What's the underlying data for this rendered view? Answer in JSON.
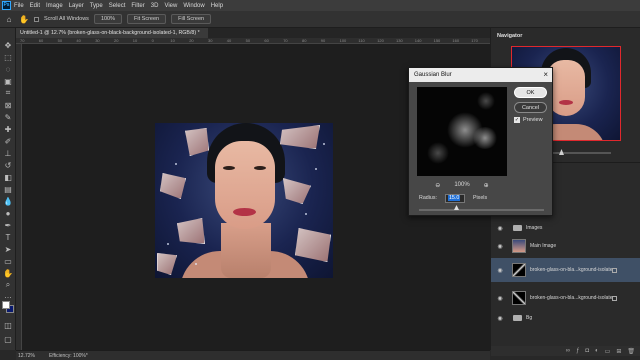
{
  "app": {
    "logo": "Ps"
  },
  "menu": [
    "File",
    "Edit",
    "Image",
    "Layer",
    "Type",
    "Select",
    "Filter",
    "3D",
    "View",
    "Window",
    "Help"
  ],
  "options": {
    "scroll_all_windows": "Scroll All Windows",
    "zoom_value": "100%",
    "fit_screen": "Fit Screen",
    "fill_screen": "Fill Screen"
  },
  "document": {
    "tab_title": "Untitled-1 @ 12.7% (broken-glass-on-black-background-isolated-1, RGB/8) *"
  },
  "rulers": [
    "70",
    "60",
    "50",
    "40",
    "30",
    "20",
    "10",
    "0",
    "10",
    "20",
    "30",
    "40",
    "50",
    "60",
    "70",
    "80",
    "90",
    "100",
    "110",
    "120",
    "130",
    "140",
    "150",
    "160",
    "170"
  ],
  "status": {
    "zoom": "12.72%",
    "efficiency": "Efficiency: 100%*"
  },
  "navigator": {
    "title": "Navigator",
    "zoom_fraction": 0.45
  },
  "layers": [
    {
      "name": "Images",
      "kind": "folder"
    },
    {
      "name": "Main Image",
      "kind": "image"
    },
    {
      "name": "broken-glass-on-bla...kground-isolated-1",
      "kind": "image",
      "selected": true
    },
    {
      "name": "broken-glass-on-bla...kground-isolated-2",
      "kind": "image"
    },
    {
      "name": "Bg",
      "kind": "folder"
    }
  ],
  "dialog": {
    "title": "Gaussian Blur",
    "ok_label": "OK",
    "cancel_label": "Cancel",
    "preview_label": "Preview",
    "zoom": "100%",
    "radius_label": "Radius:",
    "radius_value": "15.0",
    "radius_unit": "Pixels",
    "radius_fraction": 0.3
  },
  "colors": {
    "accent": "#31a8ff",
    "selected_layer": "#3f5066",
    "navigator_frame": "#e0282d"
  }
}
